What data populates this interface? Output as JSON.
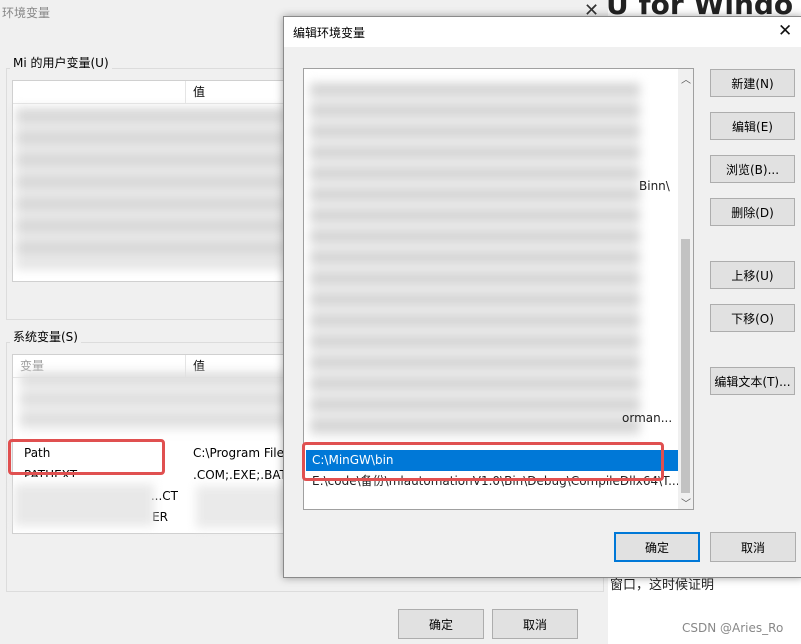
{
  "bg_window": {
    "title": "环境变量",
    "user_group_label": "Mi 的用户变量(U)",
    "user_col_value": "值",
    "system_group_label": "系统变量(S)",
    "system_col_variable": "变量",
    "system_col_value": "值",
    "system_rows": [
      {
        "name": "Path",
        "value": "C:\\Program File"
      },
      {
        "name": "PATHEXT",
        "value": ".COM;.EXE;.BAT"
      },
      {
        "name": "PROCESSOR_ARCHITECTURE",
        "value": "CT..."
      },
      {
        "name": "PROCESSOR_IDENTIFIER",
        "value": "ER"
      }
    ],
    "ok_label": "确定",
    "cancel_label": "取消"
  },
  "web_bg": {
    "heading": "U for Windo",
    "body_text": "窗口，这时候证明",
    "watermark": "CSDN @Aries_Ro"
  },
  "dialog": {
    "title": "编辑环境变量",
    "path_entries": [
      {
        "text": "C:\\MinGW\\bin",
        "selected": true
      },
      {
        "text": "E:\\code\\备份\\mlautomationV1.0\\Bin\\Debug\\CompileDllx64\\T...",
        "selected": false
      }
    ],
    "partial_texts": [
      "Binn\\",
      "orman..."
    ],
    "buttons": {
      "new": "新建(N)",
      "edit": "编辑(E)",
      "browse": "浏览(B)...",
      "delete": "删除(D)",
      "move_up": "上移(U)",
      "move_down": "下移(O)",
      "edit_text": "编辑文本(T)...",
      "ok": "确定",
      "cancel": "取消"
    }
  },
  "colors": {
    "selection": "#0078d7",
    "highlight_box": "#e05050",
    "dialog_bg": "#f0f0f0"
  }
}
